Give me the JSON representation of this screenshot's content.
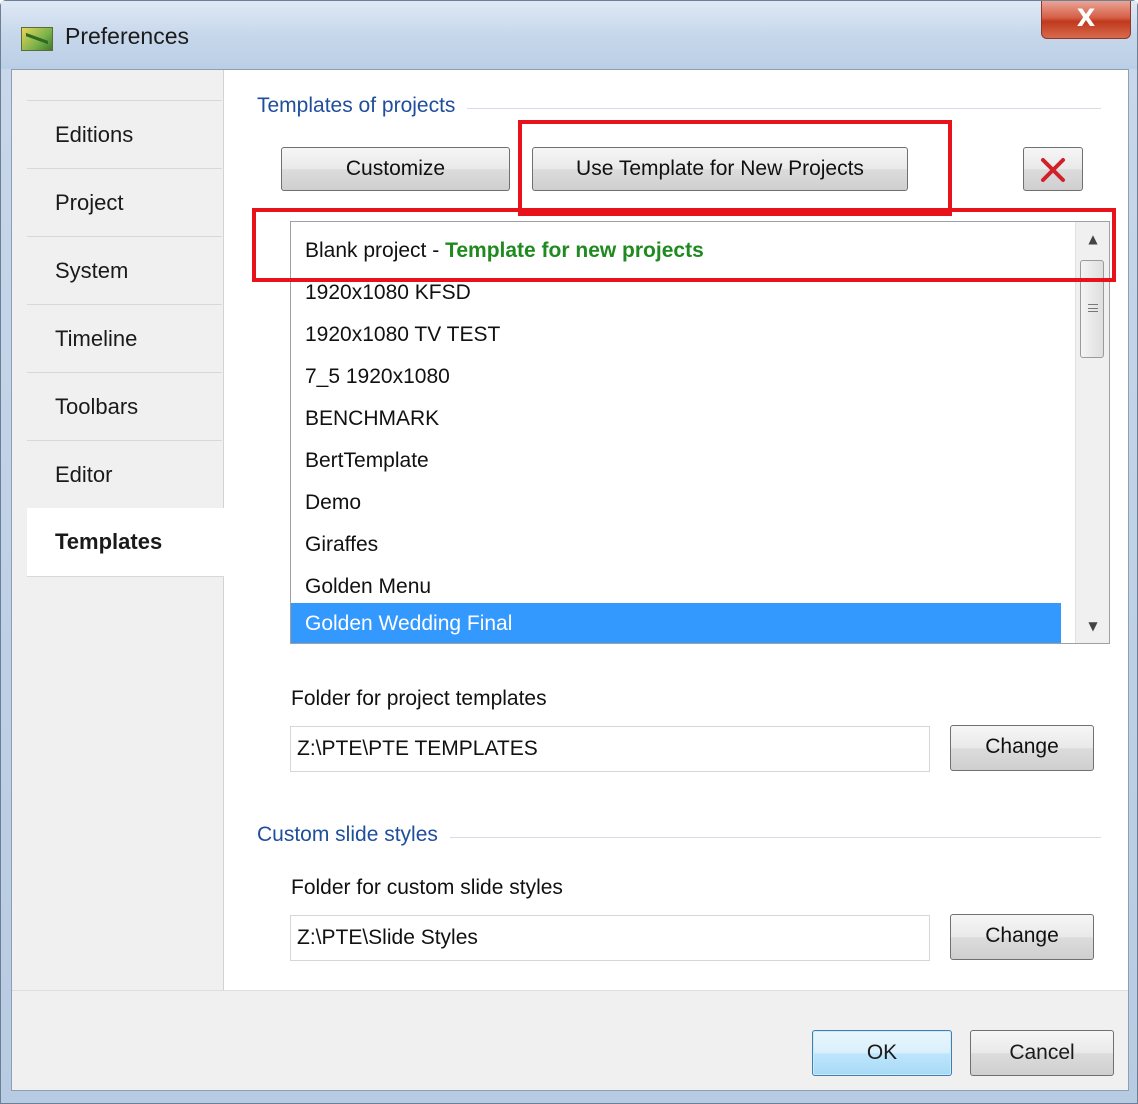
{
  "window": {
    "title": "Preferences",
    "close_glyph": "X",
    "app_icon": "preferences-app-icon"
  },
  "sidebar": {
    "items": [
      {
        "label": "Editions"
      },
      {
        "label": "Project"
      },
      {
        "label": "System"
      },
      {
        "label": "Timeline"
      },
      {
        "label": "Toolbars"
      },
      {
        "label": "Editor"
      },
      {
        "label": "Templates",
        "active": true
      }
    ]
  },
  "templates": {
    "group_title": "Templates of projects",
    "customize_label": "Customize",
    "use_template_label": "Use Template for New Projects",
    "delete_icon": "delete-x-icon",
    "list": {
      "items": [
        {
          "name": "Blank project",
          "separator": " - ",
          "tag": "Template for new projects"
        },
        {
          "name": "1920x1080 KFSD"
        },
        {
          "name": "1920x1080 TV TEST"
        },
        {
          "name": "7_5 1920x1080"
        },
        {
          "name": "BENCHMARK"
        },
        {
          "name": "BertTemplate"
        },
        {
          "name": "Demo"
        },
        {
          "name": "Giraffes"
        },
        {
          "name": "Golden Menu"
        },
        {
          "name": "Golden Wedding Final",
          "selected": true
        }
      ],
      "scroll_up_glyph": "▲",
      "scroll_down_glyph": "▼"
    },
    "folder_label": "Folder for project templates",
    "folder_value": "Z:\\PTE\\PTE TEMPLATES",
    "change_label": "Change"
  },
  "slide_styles": {
    "group_title": "Custom slide styles",
    "folder_label": "Folder for custom slide styles",
    "folder_value": "Z:\\PTE\\Slide Styles",
    "change_label": "Change"
  },
  "footer": {
    "ok_label": "OK",
    "cancel_label": "Cancel"
  },
  "colors": {
    "annotation_red": "#e8131a",
    "selection_blue": "#3399ff",
    "template_tag_green": "#1f8a1f",
    "group_title_blue": "#1f4e9c"
  }
}
